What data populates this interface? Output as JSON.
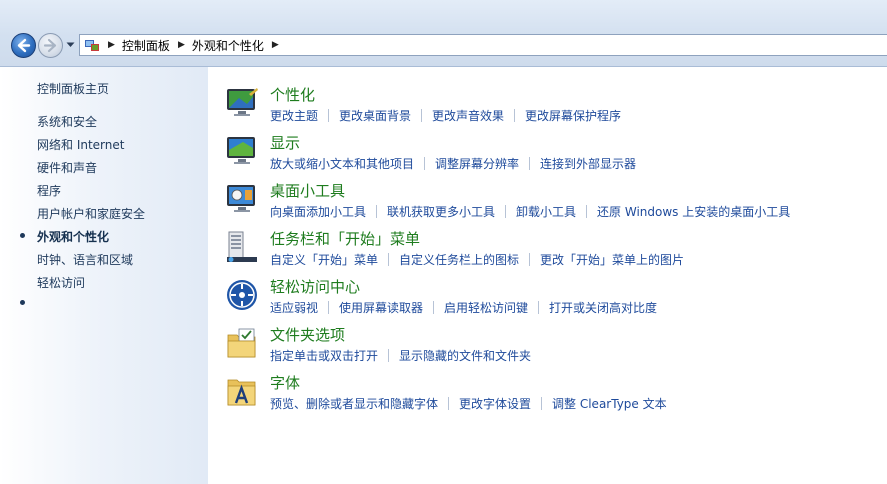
{
  "address_bar": {
    "breadcrumbs": [
      "控制面板",
      "外观和个性化"
    ]
  },
  "left_panel": {
    "home_link": "控制面板主页",
    "items": [
      {
        "label": "系统和安全",
        "current": false
      },
      {
        "label": "网络和 Internet",
        "current": false
      },
      {
        "label": "硬件和声音",
        "current": false
      },
      {
        "label": "程序",
        "current": false
      },
      {
        "label": "用户帐户和家庭安全",
        "current": false
      },
      {
        "label": "外观和个性化",
        "current": true
      },
      {
        "label": "时钟、语言和区域",
        "current": false
      },
      {
        "label": "轻松访问",
        "current": false
      }
    ]
  },
  "categories": [
    {
      "title": "个性化",
      "icon": "personalization-icon",
      "links": [
        "更改主题",
        "更改桌面背景",
        "更改声音效果",
        "更改屏幕保护程序"
      ]
    },
    {
      "title": "显示",
      "icon": "display-icon",
      "links": [
        "放大或缩小文本和其他项目",
        "调整屏幕分辨率",
        "连接到外部显示器"
      ]
    },
    {
      "title": "桌面小工具",
      "icon": "gadgets-icon",
      "links": [
        "向桌面添加小工具",
        "联机获取更多小工具",
        "卸载小工具",
        "还原 Windows 上安装的桌面小工具"
      ]
    },
    {
      "title": "任务栏和「开始」菜单",
      "icon": "taskbar-icon",
      "links": [
        "自定义「开始」菜单",
        "自定义任务栏上的图标",
        "更改「开始」菜单上的图片"
      ]
    },
    {
      "title": "轻松访问中心",
      "icon": "ease-of-access-icon",
      "links": [
        "适应弱视",
        "使用屏幕读取器",
        "启用轻松访问键",
        "打开或关闭高对比度"
      ]
    },
    {
      "title": "文件夹选项",
      "icon": "folder-options-icon",
      "links": [
        "指定单击或双击打开",
        "显示隐藏的文件和文件夹"
      ]
    },
    {
      "title": "字体",
      "icon": "fonts-icon",
      "links": [
        "预览、删除或者显示和隐藏字体",
        "更改字体设置",
        "调整 ClearType 文本"
      ]
    }
  ],
  "colors": {
    "title_green": "#1e7c1e",
    "link_blue": "#1e4a9b",
    "nav_text": "#1e395b"
  }
}
